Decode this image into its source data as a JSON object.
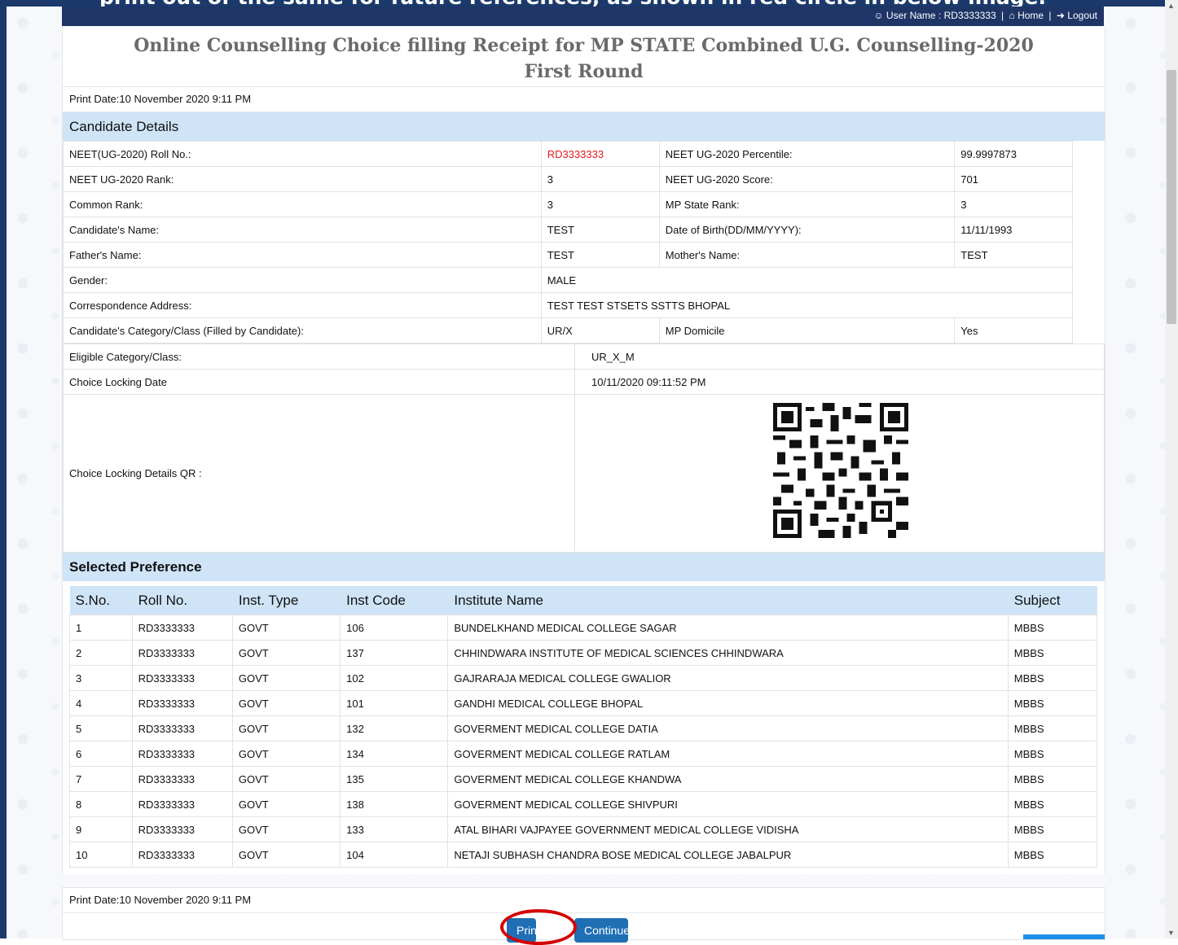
{
  "top_banner": {
    "cut_text": "print out of the same for future references, as shown in red circle in below image."
  },
  "nav": {
    "user_label": "User Name : RD3333333",
    "home": "Home",
    "logout": "Logout"
  },
  "title": {
    "line1": "Online Counselling Choice filling Receipt for MP STATE Combined U.G. Counselling-2020",
    "line2": "First Round"
  },
  "print_date": "Print Date:10 November 2020 9:11 PM",
  "candidate_section": {
    "heading": "Candidate Details",
    "rows": [
      {
        "l1": "NEET(UG-2020) Roll No.:",
        "v1": "RD3333333",
        "l2": "NEET UG-2020 Percentile:",
        "v2": "99.9997873"
      },
      {
        "l1": "NEET UG-2020 Rank:",
        "v1": "3",
        "l2": "NEET UG-2020 Score:",
        "v2": "701"
      },
      {
        "l1": "Common Rank:",
        "v1": "3",
        "l2": "MP State Rank:",
        "v2": "3"
      },
      {
        "l1": "Candidate's Name:",
        "v1": "TEST",
        "l2": "Date of Birth(DD/MM/YYYY):",
        "v2": "11/11/1993"
      },
      {
        "l1": "Father's Name:",
        "v1": "TEST",
        "l2": "Mother's Name:",
        "v2": "TEST"
      }
    ],
    "gender_label": "Gender:",
    "gender_value": "MALE",
    "address_label": "Correspondence Address:",
    "address_value": "TEST TEST STSETS SSTTS BHOPAL",
    "category_label": "Candidate's Category/Class (Filled by Candidate):",
    "category_value": "UR/X",
    "domicile_label": "MP Domicile",
    "domicile_value": "Yes"
  },
  "eligibility": {
    "eligible_label": "Eligible Category/Class:",
    "eligible_value": "UR_X_M",
    "locking_label": "Choice Locking Date",
    "locking_value": "10/11/2020 09:11:52 PM",
    "qr_label": "Choice Locking Details QR :"
  },
  "preference_section": {
    "heading": "Selected Preference",
    "columns": [
      "S.No.",
      "Roll No.",
      "Inst. Type",
      "Inst Code",
      "Institute Name",
      "Subject"
    ],
    "rows": [
      [
        "1",
        "RD3333333",
        "GOVT",
        "106",
        "BUNDELKHAND MEDICAL COLLEGE SAGAR",
        "MBBS"
      ],
      [
        "2",
        "RD3333333",
        "GOVT",
        "137",
        "CHHINDWARA INSTITUTE OF MEDICAL SCIENCES CHHINDWARA",
        "MBBS"
      ],
      [
        "3",
        "RD3333333",
        "GOVT",
        "102",
        "GAJRARAJA MEDICAL COLLEGE GWALIOR",
        "MBBS"
      ],
      [
        "4",
        "RD3333333",
        "GOVT",
        "101",
        "GANDHI MEDICAL COLLEGE BHOPAL",
        "MBBS"
      ],
      [
        "5",
        "RD3333333",
        "GOVT",
        "132",
        "GOVERMENT MEDICAL COLLEGE DATIA",
        "MBBS"
      ],
      [
        "6",
        "RD3333333",
        "GOVT",
        "134",
        "GOVERMENT MEDICAL COLLEGE RATLAM",
        "MBBS"
      ],
      [
        "7",
        "RD3333333",
        "GOVT",
        "135",
        "GOVERMENT MEDICAL COLLEGE KHANDWA",
        "MBBS"
      ],
      [
        "8",
        "RD3333333",
        "GOVT",
        "138",
        "GOVERMENT MEDICAL COLLEGE SHIVPURI",
        "MBBS"
      ],
      [
        "9",
        "RD3333333",
        "GOVT",
        "133",
        "ATAL BIHARI VAJPAYEE GOVERNMENT MEDICAL COLLEGE VIDISHA",
        "MBBS"
      ],
      [
        "10",
        "RD3333333",
        "GOVT",
        "104",
        "NETAJI SUBHASH CHANDRA BOSE MEDICAL COLLEGE JABALPUR",
        "MBBS"
      ]
    ]
  },
  "footer": {
    "print_date": "Print Date:10 November 2020 9:11 PM",
    "print_button": "Print",
    "continue_button": "Continue"
  },
  "colors": {
    "nav_bg": "#1e3566",
    "section_bg": "#cfe4f7",
    "button_bg": "#1f6fb5",
    "highlight_red": "#d40000",
    "roll_red": "#e01919"
  },
  "icons": {
    "user": "user-icon",
    "home": "home-icon",
    "logout": "logout-icon",
    "qr": "qr-code-icon"
  }
}
